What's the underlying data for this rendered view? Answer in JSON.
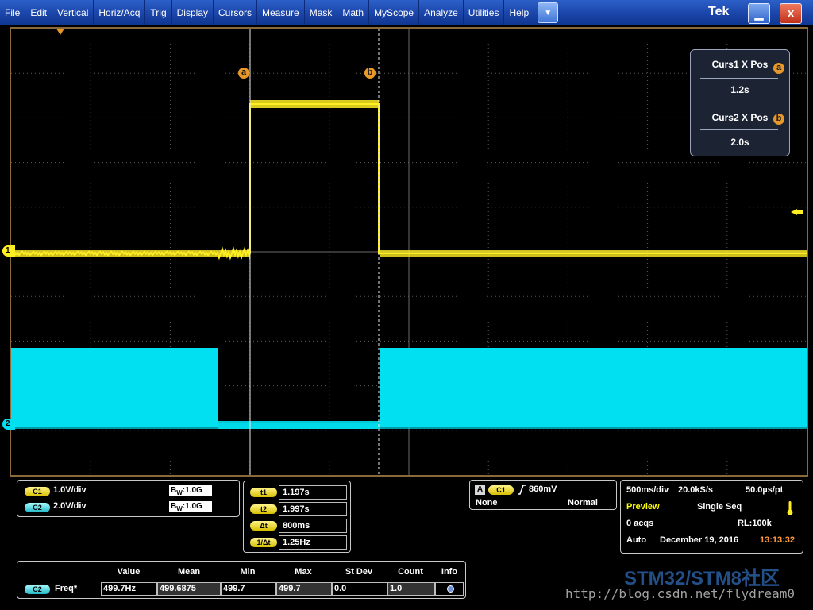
{
  "menu": {
    "items": [
      "File",
      "Edit",
      "Vertical",
      "Horiz/Acq",
      "Trig",
      "Display",
      "Cursors",
      "Measure",
      "Mask",
      "Math",
      "MyScope",
      "Analyze",
      "Utilities",
      "Help"
    ],
    "dropdown_icon": "chevron-down-icon",
    "brand": "Tek",
    "minimize_icon": "minimize-icon",
    "close_icon": "close-icon"
  },
  "waveforms": {
    "ch1": {
      "marker": "1",
      "color": "#ffee22"
    },
    "ch2": {
      "marker": "2",
      "color": "#00e0f0"
    }
  },
  "cursors": {
    "a_marker": "a",
    "b_marker": "b",
    "readout": {
      "curs1_label": "Curs1 X Pos",
      "curs1_value": "1.2s",
      "curs2_label": "Curs2 X Pos",
      "curs2_value": "2.0s"
    }
  },
  "channels": {
    "c1_badge": "C1",
    "c1_scale": "1.0V/div",
    "c1_bw_value": "1.0G",
    "c2_badge": "C2",
    "c2_scale": "2.0V/div",
    "c2_bw_value": "1.0G",
    "bw_letter_b": "B",
    "bw_letter_w": "W",
    "bw_colon": ":"
  },
  "cursor_table": {
    "rows": [
      {
        "label": "t1",
        "value": "1.197s"
      },
      {
        "label": "t2",
        "value": "1.997s"
      },
      {
        "label": "Δt",
        "value": "800ms"
      },
      {
        "label": "1/Δt",
        "value": "1.25Hz"
      }
    ]
  },
  "trigger": {
    "mode_badge": "A",
    "source_badge": "C1",
    "level": "860mV",
    "coupling": "None",
    "mode": "Normal"
  },
  "acquisition": {
    "timebase": "500ms/div",
    "sample_rate": "20.0kS/s",
    "resolution": "50.0µs/pt",
    "preview": "Preview",
    "single_seq": "Single Seq",
    "acqs": "0 acqs",
    "record_length": "RL:100k",
    "auto": "Auto",
    "date": "December 19, 2016",
    "time": "13:13:32",
    "accent_color": "#ffff00",
    "time_color": "#ff9a3c"
  },
  "measurement": {
    "headers": [
      "Value",
      "Mean",
      "Min",
      "Max",
      "St Dev",
      "Count",
      "Info"
    ],
    "source_badge": "C2",
    "name": "Freq*",
    "value": "499.7Hz",
    "mean": "499.6875",
    "min": "499.7",
    "max": "499.7",
    "st_dev": "0.0",
    "count": "1.0",
    "info_icon": "info-dot-icon"
  },
  "watermark": {
    "site": "STM32/STM8社区",
    "url": "http://blog.csdn.net/flydream0"
  }
}
